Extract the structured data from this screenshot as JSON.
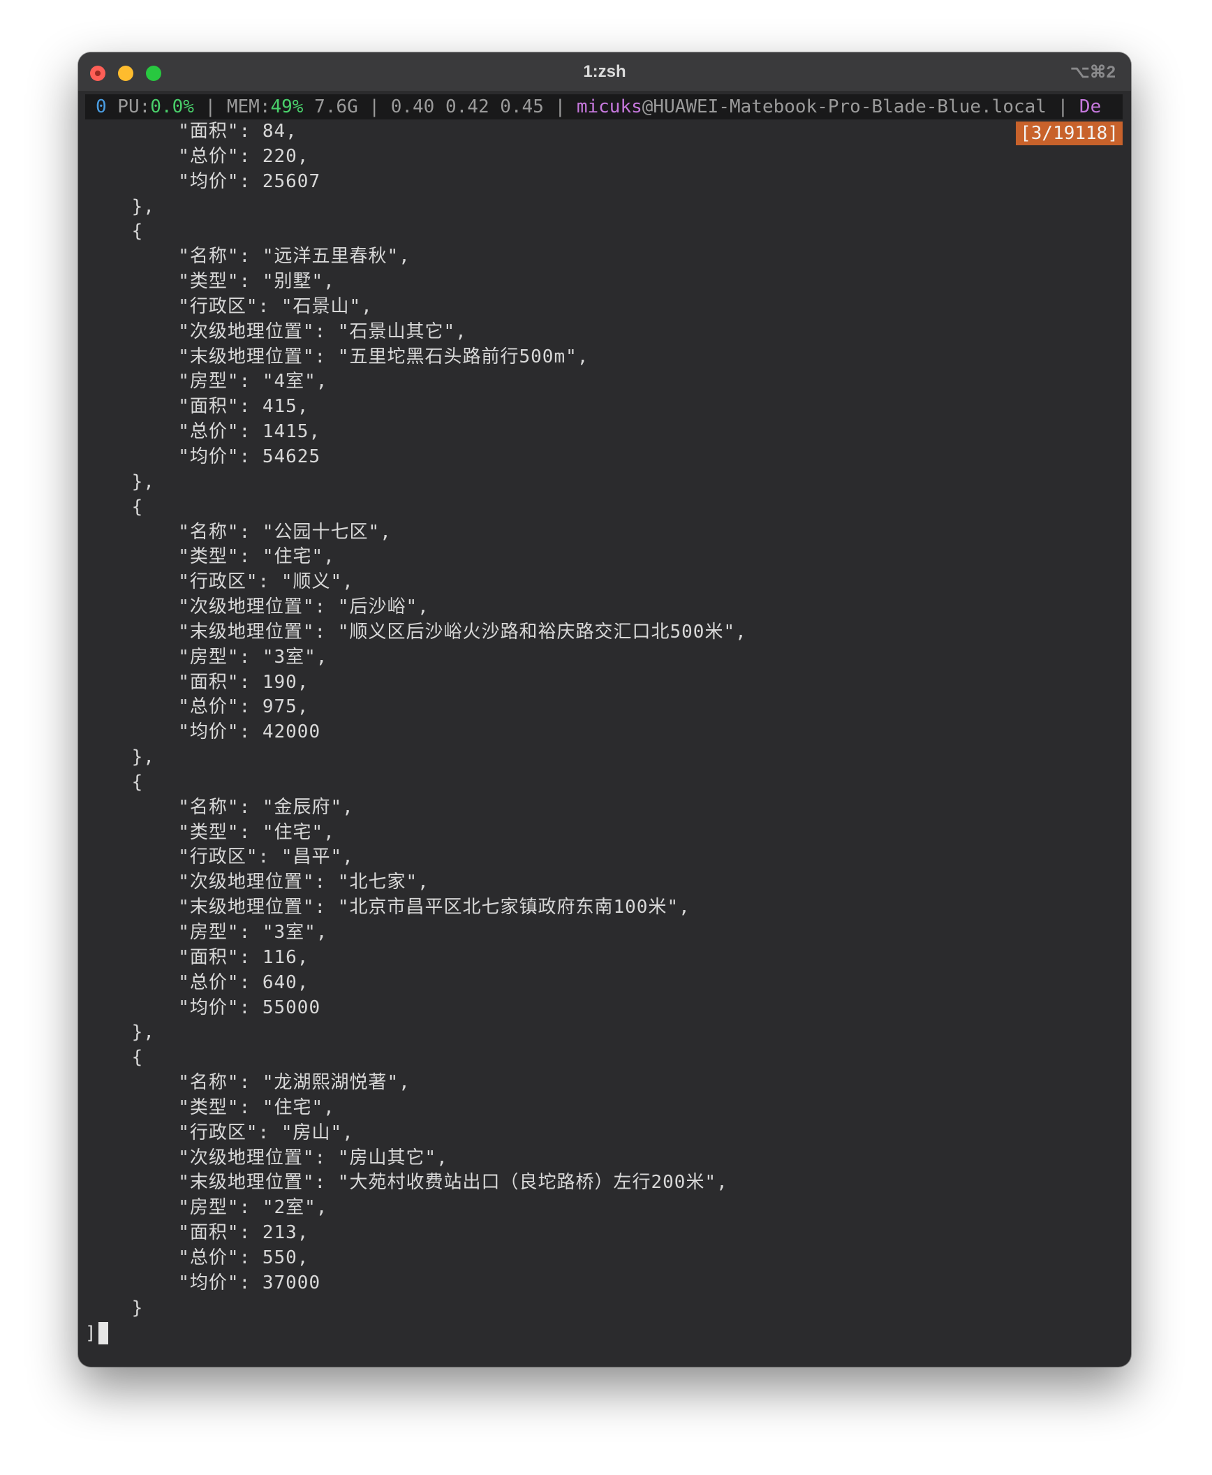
{
  "window": {
    "title": "1:zsh",
    "shortcut": "⌥⌘2"
  },
  "status_bar": {
    "cpu_prefix": "0",
    "cpu_label": " PU:",
    "cpu_value": "0.0%",
    "sep1": " | ",
    "mem_label": "MEM:",
    "mem_percent": "49%",
    "mem_size": " 7.6G",
    "sep2": " | ",
    "load": "0.40 0.42 0.45",
    "sep3": " | ",
    "user": "micuks",
    "host": "@HUAWEI-Matebook-Pro-Blade-Blue.local",
    "sep4": " | ",
    "tail": "De"
  },
  "pager": "[3/19118]",
  "lines": [
    "        \"面积\": 84,",
    "        \"总价\": 220,",
    "        \"均价\": 25607",
    "    },",
    "    {",
    "        \"名称\": \"远洋五里春秋\",",
    "        \"类型\": \"别墅\",",
    "        \"行政区\": \"石景山\",",
    "        \"次级地理位置\": \"石景山其它\",",
    "        \"末级地理位置\": \"五里坨黑石头路前行500m\",",
    "        \"房型\": \"4室\",",
    "        \"面积\": 415,",
    "        \"总价\": 1415,",
    "        \"均价\": 54625",
    "    },",
    "    {",
    "        \"名称\": \"公园十七区\",",
    "        \"类型\": \"住宅\",",
    "        \"行政区\": \"顺义\",",
    "        \"次级地理位置\": \"后沙峪\",",
    "        \"末级地理位置\": \"顺义区后沙峪火沙路和裕庆路交汇口北500米\",",
    "        \"房型\": \"3室\",",
    "        \"面积\": 190,",
    "        \"总价\": 975,",
    "        \"均价\": 42000",
    "    },",
    "    {",
    "        \"名称\": \"金辰府\",",
    "        \"类型\": \"住宅\",",
    "        \"行政区\": \"昌平\",",
    "        \"次级地理位置\": \"北七家\",",
    "        \"末级地理位置\": \"北京市昌平区北七家镇政府东南100米\",",
    "        \"房型\": \"3室\",",
    "        \"面积\": 116,",
    "        \"总价\": 640,",
    "        \"均价\": 55000",
    "    },",
    "    {",
    "        \"名称\": \"龙湖熙湖悦著\",",
    "        \"类型\": \"住宅\",",
    "        \"行政区\": \"房山\",",
    "        \"次级地理位置\": \"房山其它\",",
    "        \"末级地理位置\": \"大苑村收费站出口（良坨路桥）左行200米\",",
    "        \"房型\": \"2室\",",
    "        \"面积\": 213,",
    "        \"总价\": 550,",
    "        \"均价\": 37000",
    "    }",
    "]"
  ]
}
